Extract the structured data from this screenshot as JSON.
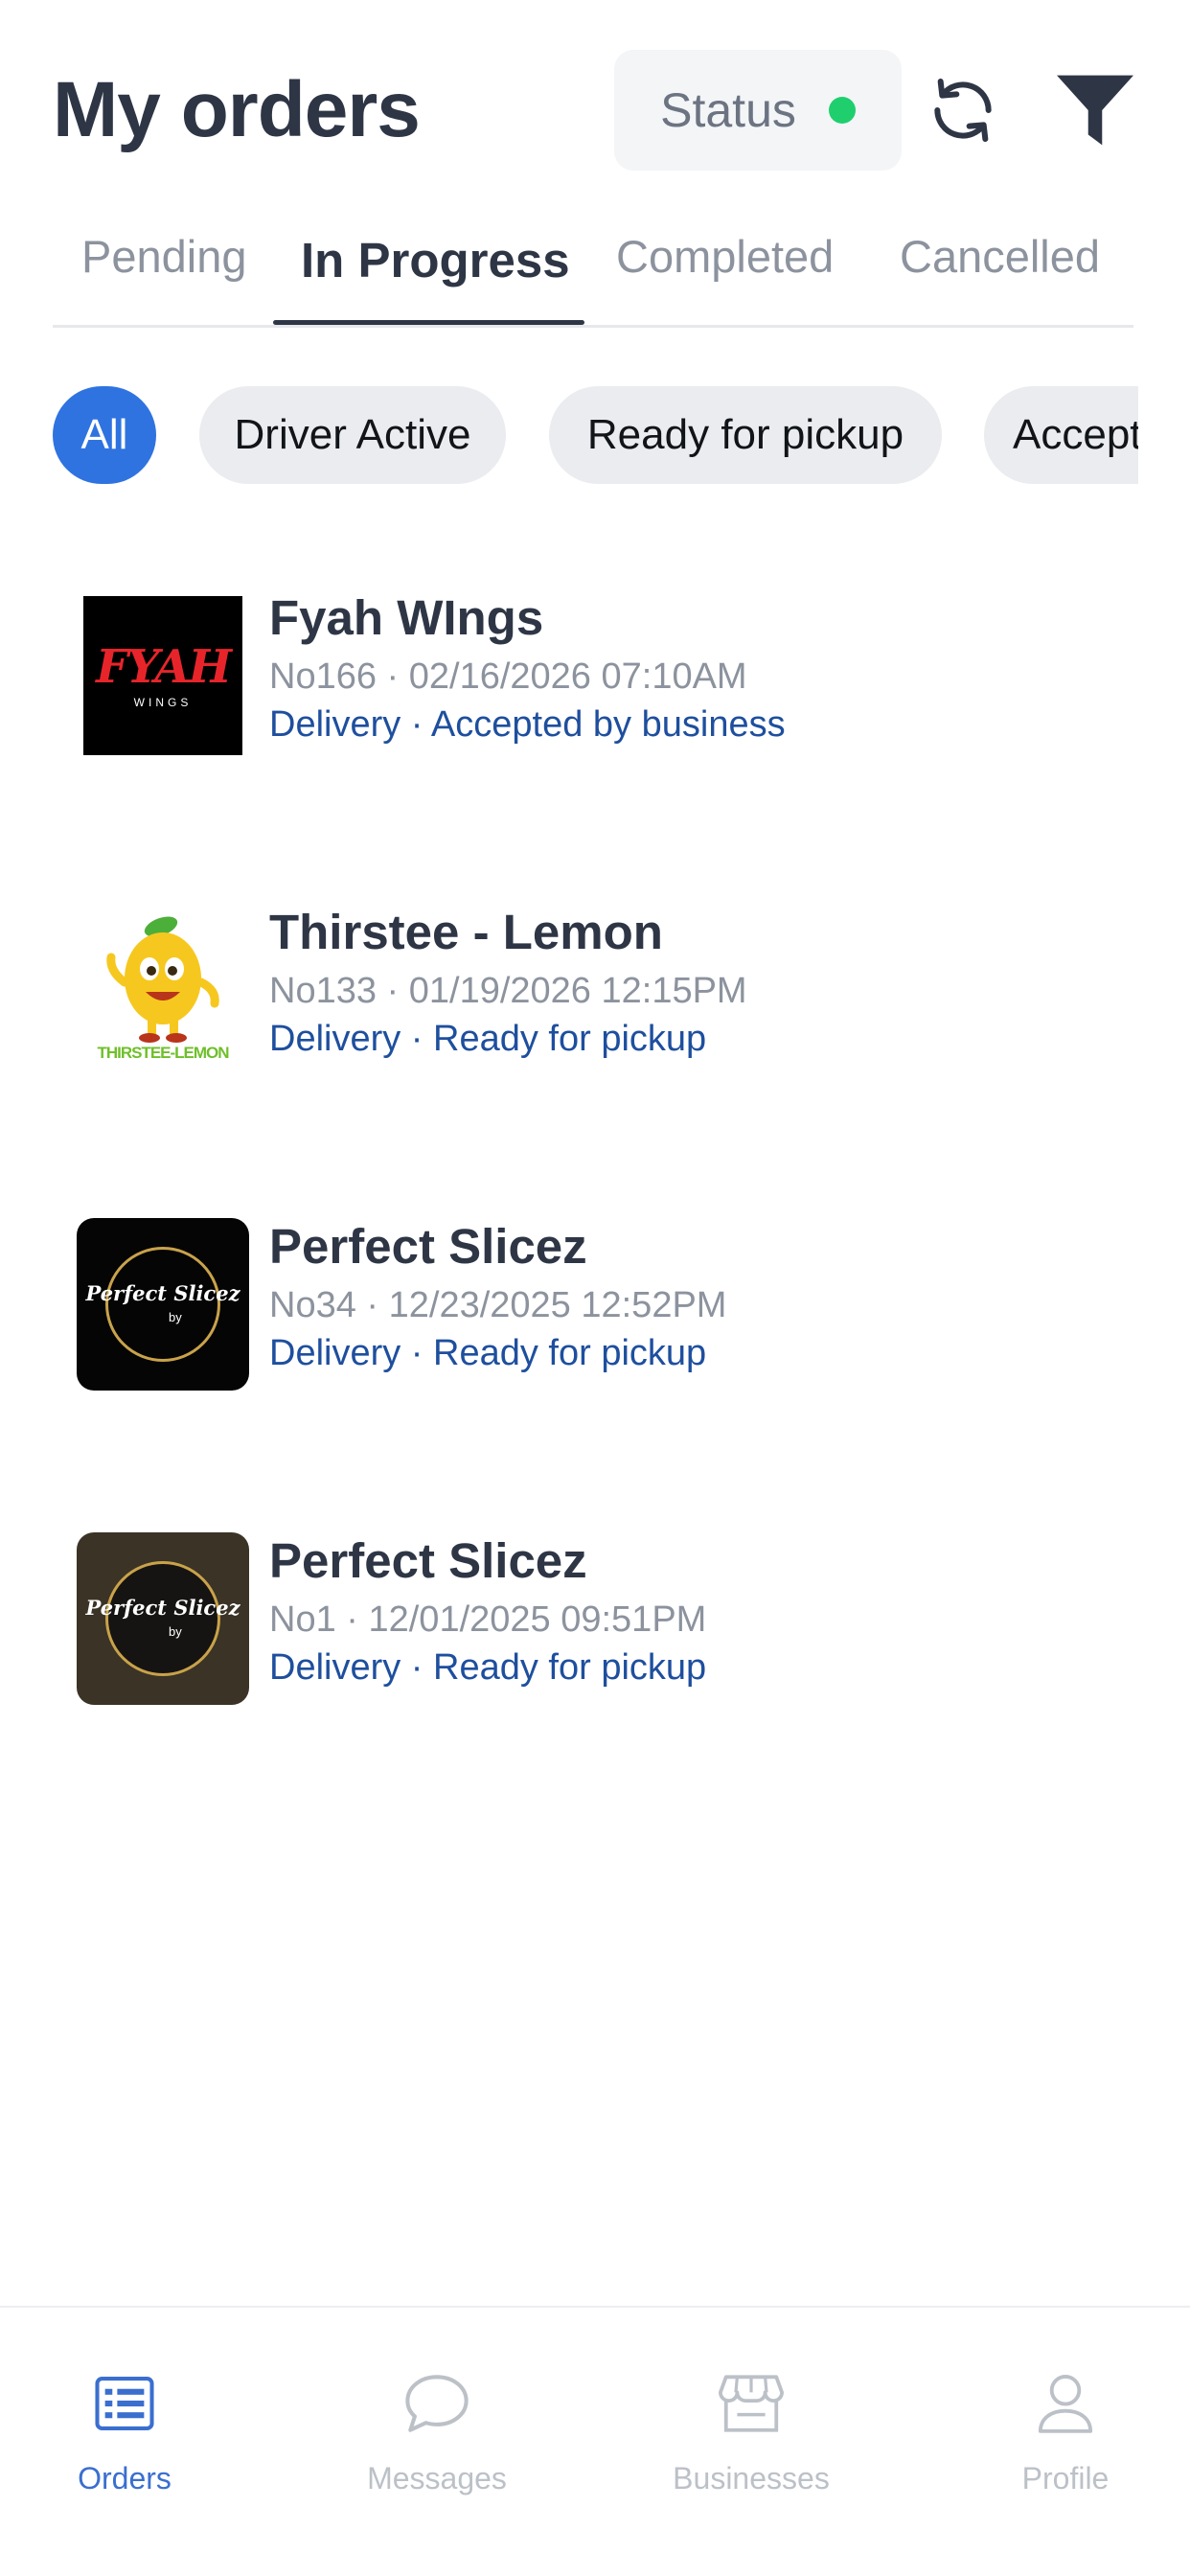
{
  "header": {
    "title": "My orders",
    "status_label": "Status",
    "status_color": "#1fcf6e",
    "refresh_icon": "refresh-icon",
    "filter_icon": "filter-icon"
  },
  "tabs": [
    {
      "label": "Pending",
      "active": false
    },
    {
      "label": "In Progress",
      "active": true
    },
    {
      "label": "Completed",
      "active": false
    },
    {
      "label": "Cancelled",
      "active": false
    }
  ],
  "chips": [
    {
      "label": "All",
      "active": true
    },
    {
      "label": "Driver Active",
      "active": false
    },
    {
      "label": "Ready for pickup",
      "active": false
    },
    {
      "label": "Accepted by business",
      "active": false
    }
  ],
  "orders": [
    {
      "name": "Fyah WIngs",
      "meta": "No166 · 02/16/2026 07:10AM",
      "status": "Delivery · Accepted by business",
      "logo_text": "FYAH",
      "logo_sub": "WINGS"
    },
    {
      "name": "Thirstee - Lemon",
      "meta": "No133 · 01/19/2026 12:15PM",
      "status": "Delivery · Ready for pickup",
      "logo_text": "THIRSTEE-LEMON"
    },
    {
      "name": "Perfect Slicez",
      "meta": "No34 · 12/23/2025 12:52PM",
      "status": "Delivery · Ready for pickup",
      "logo_text": "Perfect Slicez",
      "logo_sub": "by"
    },
    {
      "name": "Perfect Slicez",
      "meta": "No1 · 12/01/2025 09:51PM",
      "status": "Delivery · Ready for pickup",
      "logo_text": "Perfect Slicez",
      "logo_sub": "by"
    }
  ],
  "bottom_nav": [
    {
      "label": "Orders",
      "icon": "orders-list-icon",
      "active": true
    },
    {
      "label": "Messages",
      "icon": "chat-bubble-icon",
      "active": false
    },
    {
      "label": "Businesses",
      "icon": "storefront-icon",
      "active": false
    },
    {
      "label": "Profile",
      "icon": "person-icon",
      "active": false
    }
  ],
  "colors": {
    "accent": "#2f73e0",
    "status_blue": "#1e4f9e",
    "title": "#2e3646"
  }
}
